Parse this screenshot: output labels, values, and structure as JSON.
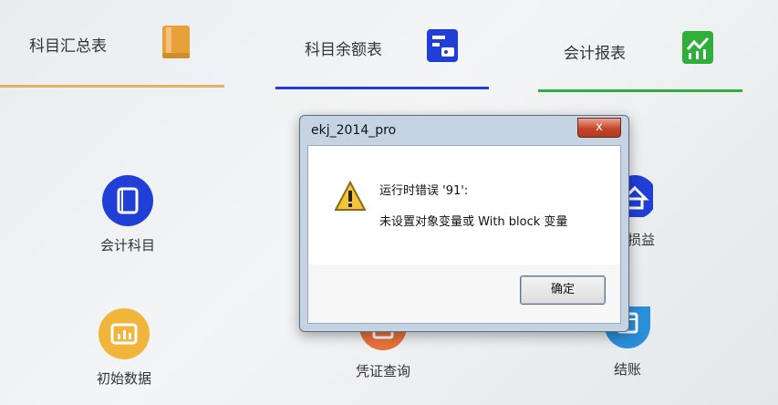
{
  "tabs": [
    {
      "label": "科目汇总表",
      "icon": "book-icon",
      "color": "#e8a13a"
    },
    {
      "label": "科目余额表",
      "icon": "wallet-icon",
      "color": "#1f3fd6"
    },
    {
      "label": "会计报表",
      "icon": "chart-icon",
      "color": "#2fae3a"
    }
  ],
  "apps": {
    "accounts": {
      "label": "会计科目",
      "icon": "book-icon",
      "color": "#1f3fd6"
    },
    "pnl": {
      "label": "损益",
      "icon": "home-icon"
    },
    "initial": {
      "label": "初始数据",
      "icon": "chart-icon",
      "color": "#f2b53b"
    },
    "voucher": {
      "label": "凭证查询",
      "icon": "document-icon",
      "color": "#e8723a"
    },
    "closing": {
      "label": "结账",
      "icon": "calendar-icon",
      "color": "#2a8fd8"
    }
  },
  "dialog": {
    "title": "ekj_2014_pro",
    "close_label": "x",
    "message_line1": "运行时错误 '91':",
    "message_line2": "未设置对象变量或 With block 变量",
    "ok_label": "确定",
    "icon": "warning-icon"
  }
}
